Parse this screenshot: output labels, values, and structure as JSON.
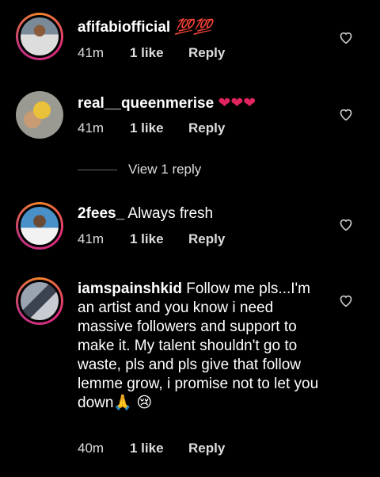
{
  "comments": [
    {
      "username": "afifabiofficial",
      "text": "💯💯",
      "time": "41m",
      "likes": "1 like",
      "reply": "Reply"
    },
    {
      "username": "real__queenmerise",
      "text": "❤❤❤",
      "time": "41m",
      "likes": "1 like",
      "reply": "Reply",
      "view_replies": "View 1 reply"
    },
    {
      "username": "2fees_",
      "text": "Always fresh",
      "time": "41m",
      "likes": "1 like",
      "reply": "Reply"
    },
    {
      "username": "iamspainshkid",
      "text": "Follow me pls...I'm an artist and you know i need massive followers and support to make it. My talent shouldn't go to waste, pls and pls give that follow lemme grow, i promise not to let you down🙏 😢",
      "time": "40m",
      "likes": "1 like",
      "reply": "Reply"
    }
  ],
  "icons": {
    "like": "heart-outline-icon"
  },
  "colors": {
    "background": "#000000",
    "text": "#ffffff",
    "heart_red": "#e0245e",
    "hundred_red": "#ff3b3b"
  }
}
